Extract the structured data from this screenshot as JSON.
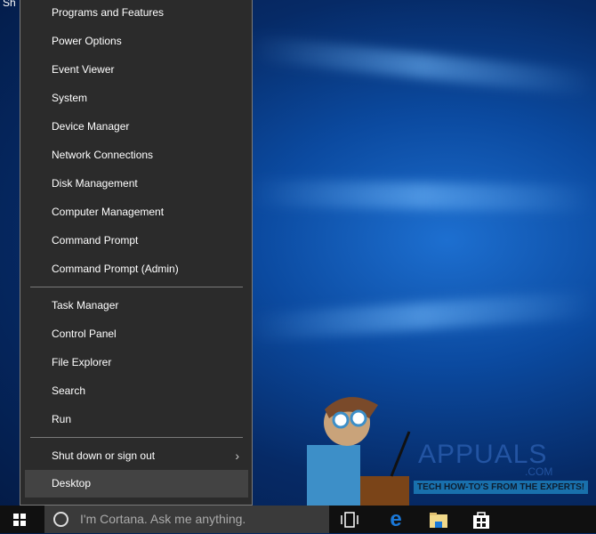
{
  "desktop": {
    "partial_text": "Sh"
  },
  "menu": {
    "group1": [
      "Programs and Features",
      "Power Options",
      "Event Viewer",
      "System",
      "Device Manager",
      "Network Connections",
      "Disk Management",
      "Computer Management",
      "Command Prompt",
      "Command Prompt (Admin)"
    ],
    "group2": [
      "Task Manager",
      "Control Panel",
      "File Explorer",
      "Search",
      "Run"
    ],
    "shutdown": "Shut down or sign out",
    "desktop": "Desktop"
  },
  "taskbar": {
    "search_placeholder": "I'm Cortana. Ask me anything."
  },
  "watermark": {
    "brand": "APPUALS",
    "domain": ".COM",
    "tagline": "TECH HOW-TO'S FROM THE EXPERTS!"
  }
}
